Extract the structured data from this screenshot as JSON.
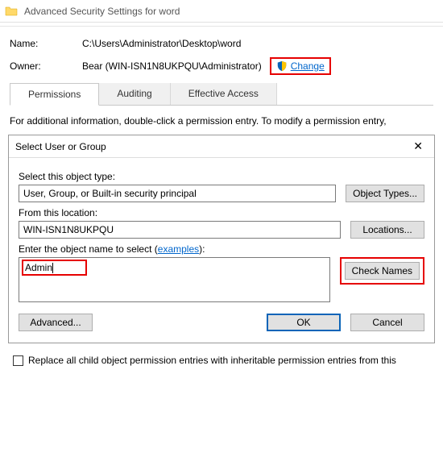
{
  "window": {
    "title": "Advanced Security Settings for word"
  },
  "info": {
    "name_label": "Name:",
    "name_value": "C:\\Users\\Administrator\\Desktop\\word",
    "owner_label": "Owner:",
    "owner_value": "Bear (WIN-ISN1N8UKPQU\\Administrator)",
    "change_link": "Change"
  },
  "tabs": {
    "permissions": "Permissions",
    "auditing": "Auditing",
    "effective": "Effective Access"
  },
  "hint": "For additional information, double-click a permission entry. To modify a permission entry,",
  "dialog": {
    "title": "Select User or Group",
    "object_type_label": "Select this object type:",
    "object_type_value": "User, Group, or Built-in security principal",
    "object_types_btn": "Object Types...",
    "location_label": "From this location:",
    "location_value": "WIN-ISN1N8UKPQU",
    "locations_btn": "Locations...",
    "enter_label_prefix": "Enter the object name to select (",
    "examples_link": "examples",
    "enter_label_suffix": "):",
    "object_input_value": "Admin",
    "check_names_btn": "Check Names",
    "advanced_btn": "Advanced...",
    "ok_btn": "OK",
    "cancel_btn": "Cancel"
  },
  "replace_label": "Replace all child object permission entries with inheritable permission entries from this"
}
